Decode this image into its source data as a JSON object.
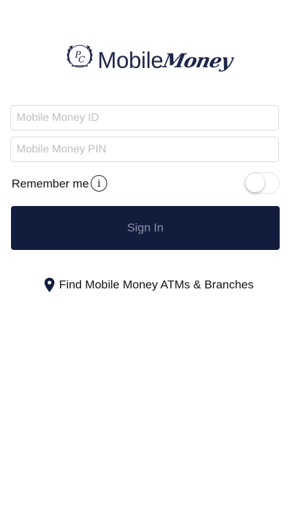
{
  "logo": {
    "word_1": "Mobile",
    "word_2": "Money",
    "emblem_icon": "pc-wreath-monogram-icon"
  },
  "login": {
    "id_placeholder": "Mobile Money ID",
    "id_value": "",
    "pin_placeholder": "Mobile Money PIN",
    "pin_value": "",
    "remember_label": "Remember me",
    "remember_on": false,
    "info_glyph": "i",
    "sign_in_label": "Sign In"
  },
  "find": {
    "icon": "location-pin-icon",
    "label": "Find Mobile Money ATMs & Branches"
  },
  "colors": {
    "brand_navy": "#121d3e",
    "logo_navy": "#1e2749",
    "button_text": "#8a91a8",
    "placeholder": "#bfbfc4",
    "border": "#d9d9d9"
  }
}
